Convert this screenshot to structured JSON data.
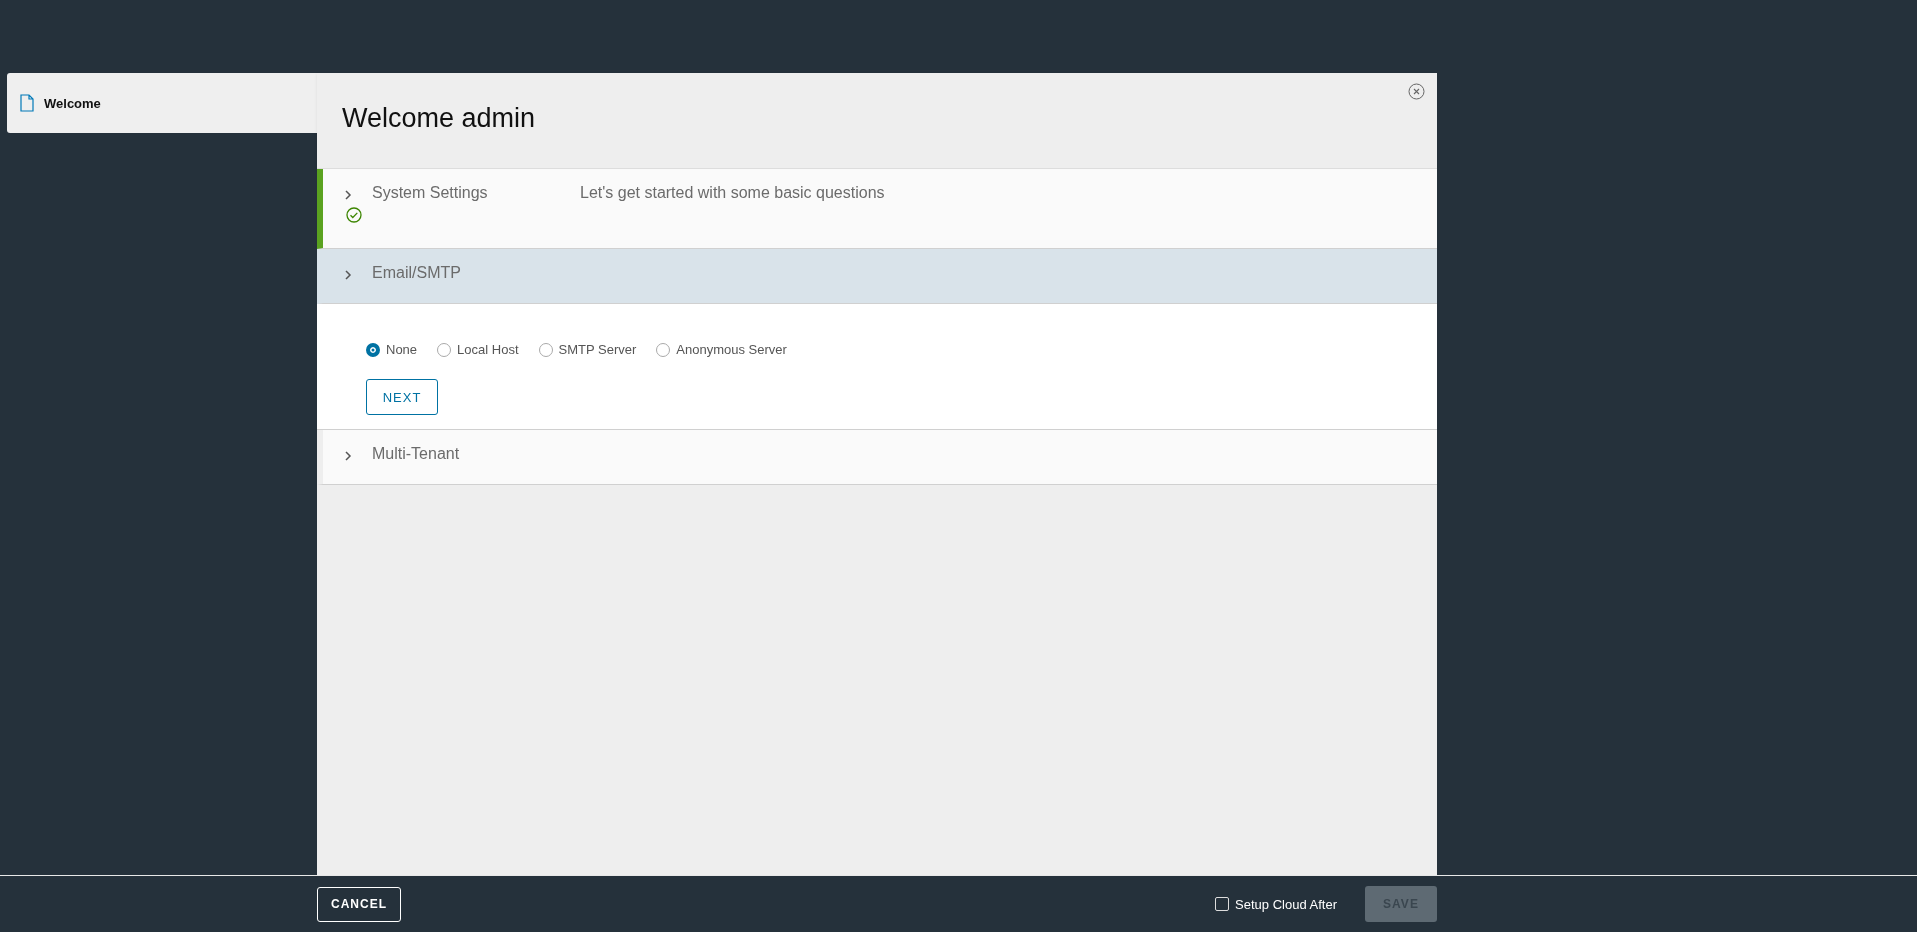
{
  "sidebar": {
    "tabs": [
      {
        "label": "Welcome",
        "selected": true
      }
    ]
  },
  "dialog": {
    "title": "Welcome admin",
    "sections": [
      {
        "title": "System Settings",
        "description": "Let's get started with some basic questions",
        "completed": true,
        "expanded": false
      },
      {
        "title": "Email/SMTP",
        "completed": false,
        "expanded": true,
        "options": [
          {
            "label": "None",
            "selected": true
          },
          {
            "label": "Local Host",
            "selected": false
          },
          {
            "label": "SMTP Server",
            "selected": false
          },
          {
            "label": "Anonymous Server",
            "selected": false
          }
        ],
        "button": "NEXT"
      },
      {
        "title": "Multi-Tenant",
        "completed": false,
        "expanded": false
      }
    ]
  },
  "footer": {
    "cancel": "CANCEL",
    "checkbox": {
      "label": "Setup Cloud After",
      "checked": false
    },
    "save": {
      "label": "SAVE",
      "disabled": true
    }
  }
}
